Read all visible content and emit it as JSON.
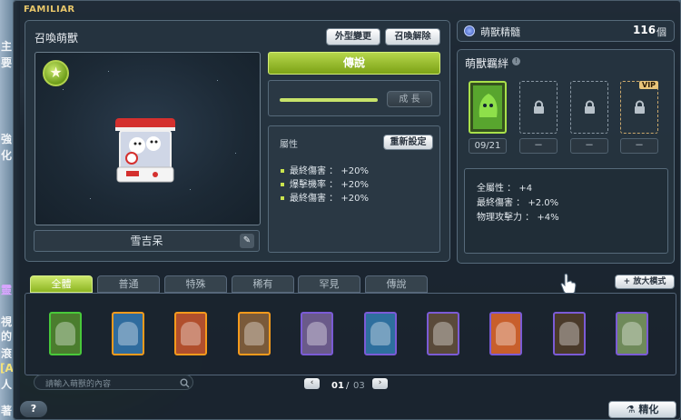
{
  "window": {
    "title": "FAMILIAR"
  },
  "left_edge": {
    "chars": [
      "主",
      "要",
      "強",
      "化",
      "靈",
      "視",
      "的",
      "滾",
      "[A",
      "人",
      "著"
    ]
  },
  "summon_panel": {
    "title": "召喚萌獸",
    "appearance_button": "外型變更",
    "dismiss_button": "召喚解除",
    "familiar_name": "雪吉呆",
    "rank_label": "傳說",
    "growth_button": "成 長",
    "attribute_title": "屬性",
    "reset_button": "重新設定",
    "attributes": [
      "最終傷害 ： +20%",
      "爆擊機率 ： +20%",
      "最終傷害 ： +20%"
    ]
  },
  "essence": {
    "label": "萌獸精髓",
    "value": "116",
    "unit": "個"
  },
  "bond_panel": {
    "title": "萌獸羈絆",
    "slots": [
      {
        "label": "09/21",
        "state": "filled"
      },
      {
        "label": "－",
        "state": "locked"
      },
      {
        "label": "－",
        "state": "locked"
      },
      {
        "label": "－",
        "state": "vip",
        "badge": "VIP"
      }
    ],
    "bonuses": [
      "全屬性 ： +4",
      "最終傷害 ： +2.0%",
      "物理攻擊力 ： +4%"
    ]
  },
  "tabs": [
    "全體",
    "普通",
    "特殊",
    "稀有",
    "罕見",
    "傳說"
  ],
  "zoom_button": "+ 放大模式",
  "cards": [
    {
      "border": "#49c93a",
      "bg": "#4b7d2e"
    },
    {
      "border": "#f59a1c",
      "bg": "#2f6c9e"
    },
    {
      "border": "#f59a1c",
      "bg": "#b14f2d"
    },
    {
      "border": "#f59a1c",
      "bg": "#7a5a3a"
    },
    {
      "border": "#7b5bd6",
      "bg": "#6a5a8a"
    },
    {
      "border": "#7b5bd6",
      "bg": "#2e6f9e"
    },
    {
      "border": "#7b5bd6",
      "bg": "#5a4a3a"
    },
    {
      "border": "#7b5bd6",
      "bg": "#c85f2c"
    },
    {
      "border": "#7b5bd6",
      "bg": "#4a3a2a"
    },
    {
      "border": "#7b5bd6",
      "bg": "#6f8a5a"
    }
  ],
  "search": {
    "placeholder": "請輸入萌獸的內容"
  },
  "pagination": {
    "current": "01",
    "separator": "/",
    "total": "03",
    "prev": "‹",
    "next": "›"
  },
  "help_button": "?",
  "refine_button": "精化"
}
